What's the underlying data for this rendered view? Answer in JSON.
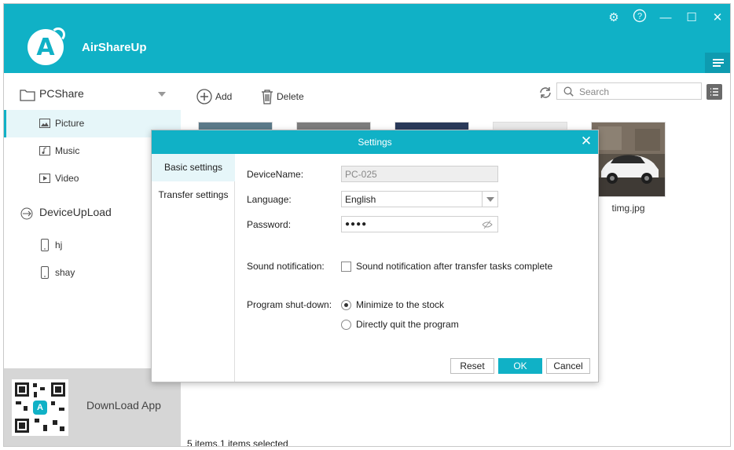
{
  "app": {
    "title": "AirShareUp",
    "logo_letter": "A",
    "accent_color": "#10b1c6"
  },
  "titlebar": {
    "icons": [
      "gear-icon",
      "help-icon",
      "minimize-icon",
      "maximize-icon",
      "close-icon"
    ],
    "settings_glyph": "⚙",
    "help_glyph": "?",
    "minimize_glyph": "—",
    "maximize_glyph": "☐",
    "close_glyph": "✕"
  },
  "sidebar": {
    "pcshare": "PCShare",
    "picture": "Picture",
    "music": "Music",
    "video": "Video",
    "deviceupload": "DeviceUpLoad",
    "device1": "hj",
    "device2": "shay"
  },
  "download": {
    "text": "DownLoad App",
    "close_glyph": "×"
  },
  "toolbar": {
    "add": "Add",
    "delete": "Delete",
    "search_placeholder": "Search"
  },
  "gallery": {
    "visible_label": "timg.jpg",
    "status": "5 items,1 items selected"
  },
  "dialog": {
    "title": "Settings",
    "tab_basic": "Basic settings",
    "tab_transfer": "Transfer settings",
    "device_name_label": "DeviceName:",
    "device_name_value": "PC-025",
    "language_label": "Language:",
    "language_value": "English",
    "password_label": "Password:",
    "password_value": "●●●●",
    "sound_label": "Sound notification:",
    "sound_option": "Sound notification after transfer tasks complete",
    "sound_checked": false,
    "shutdown_label": "Program shut-down:",
    "shutdown_opt1": "Minimize to the stock",
    "shutdown_opt2": "Directly quit the program",
    "shutdown_selected": "Minimize to the stock",
    "reset": "Reset",
    "ok": "OK",
    "cancel": "Cancel"
  }
}
